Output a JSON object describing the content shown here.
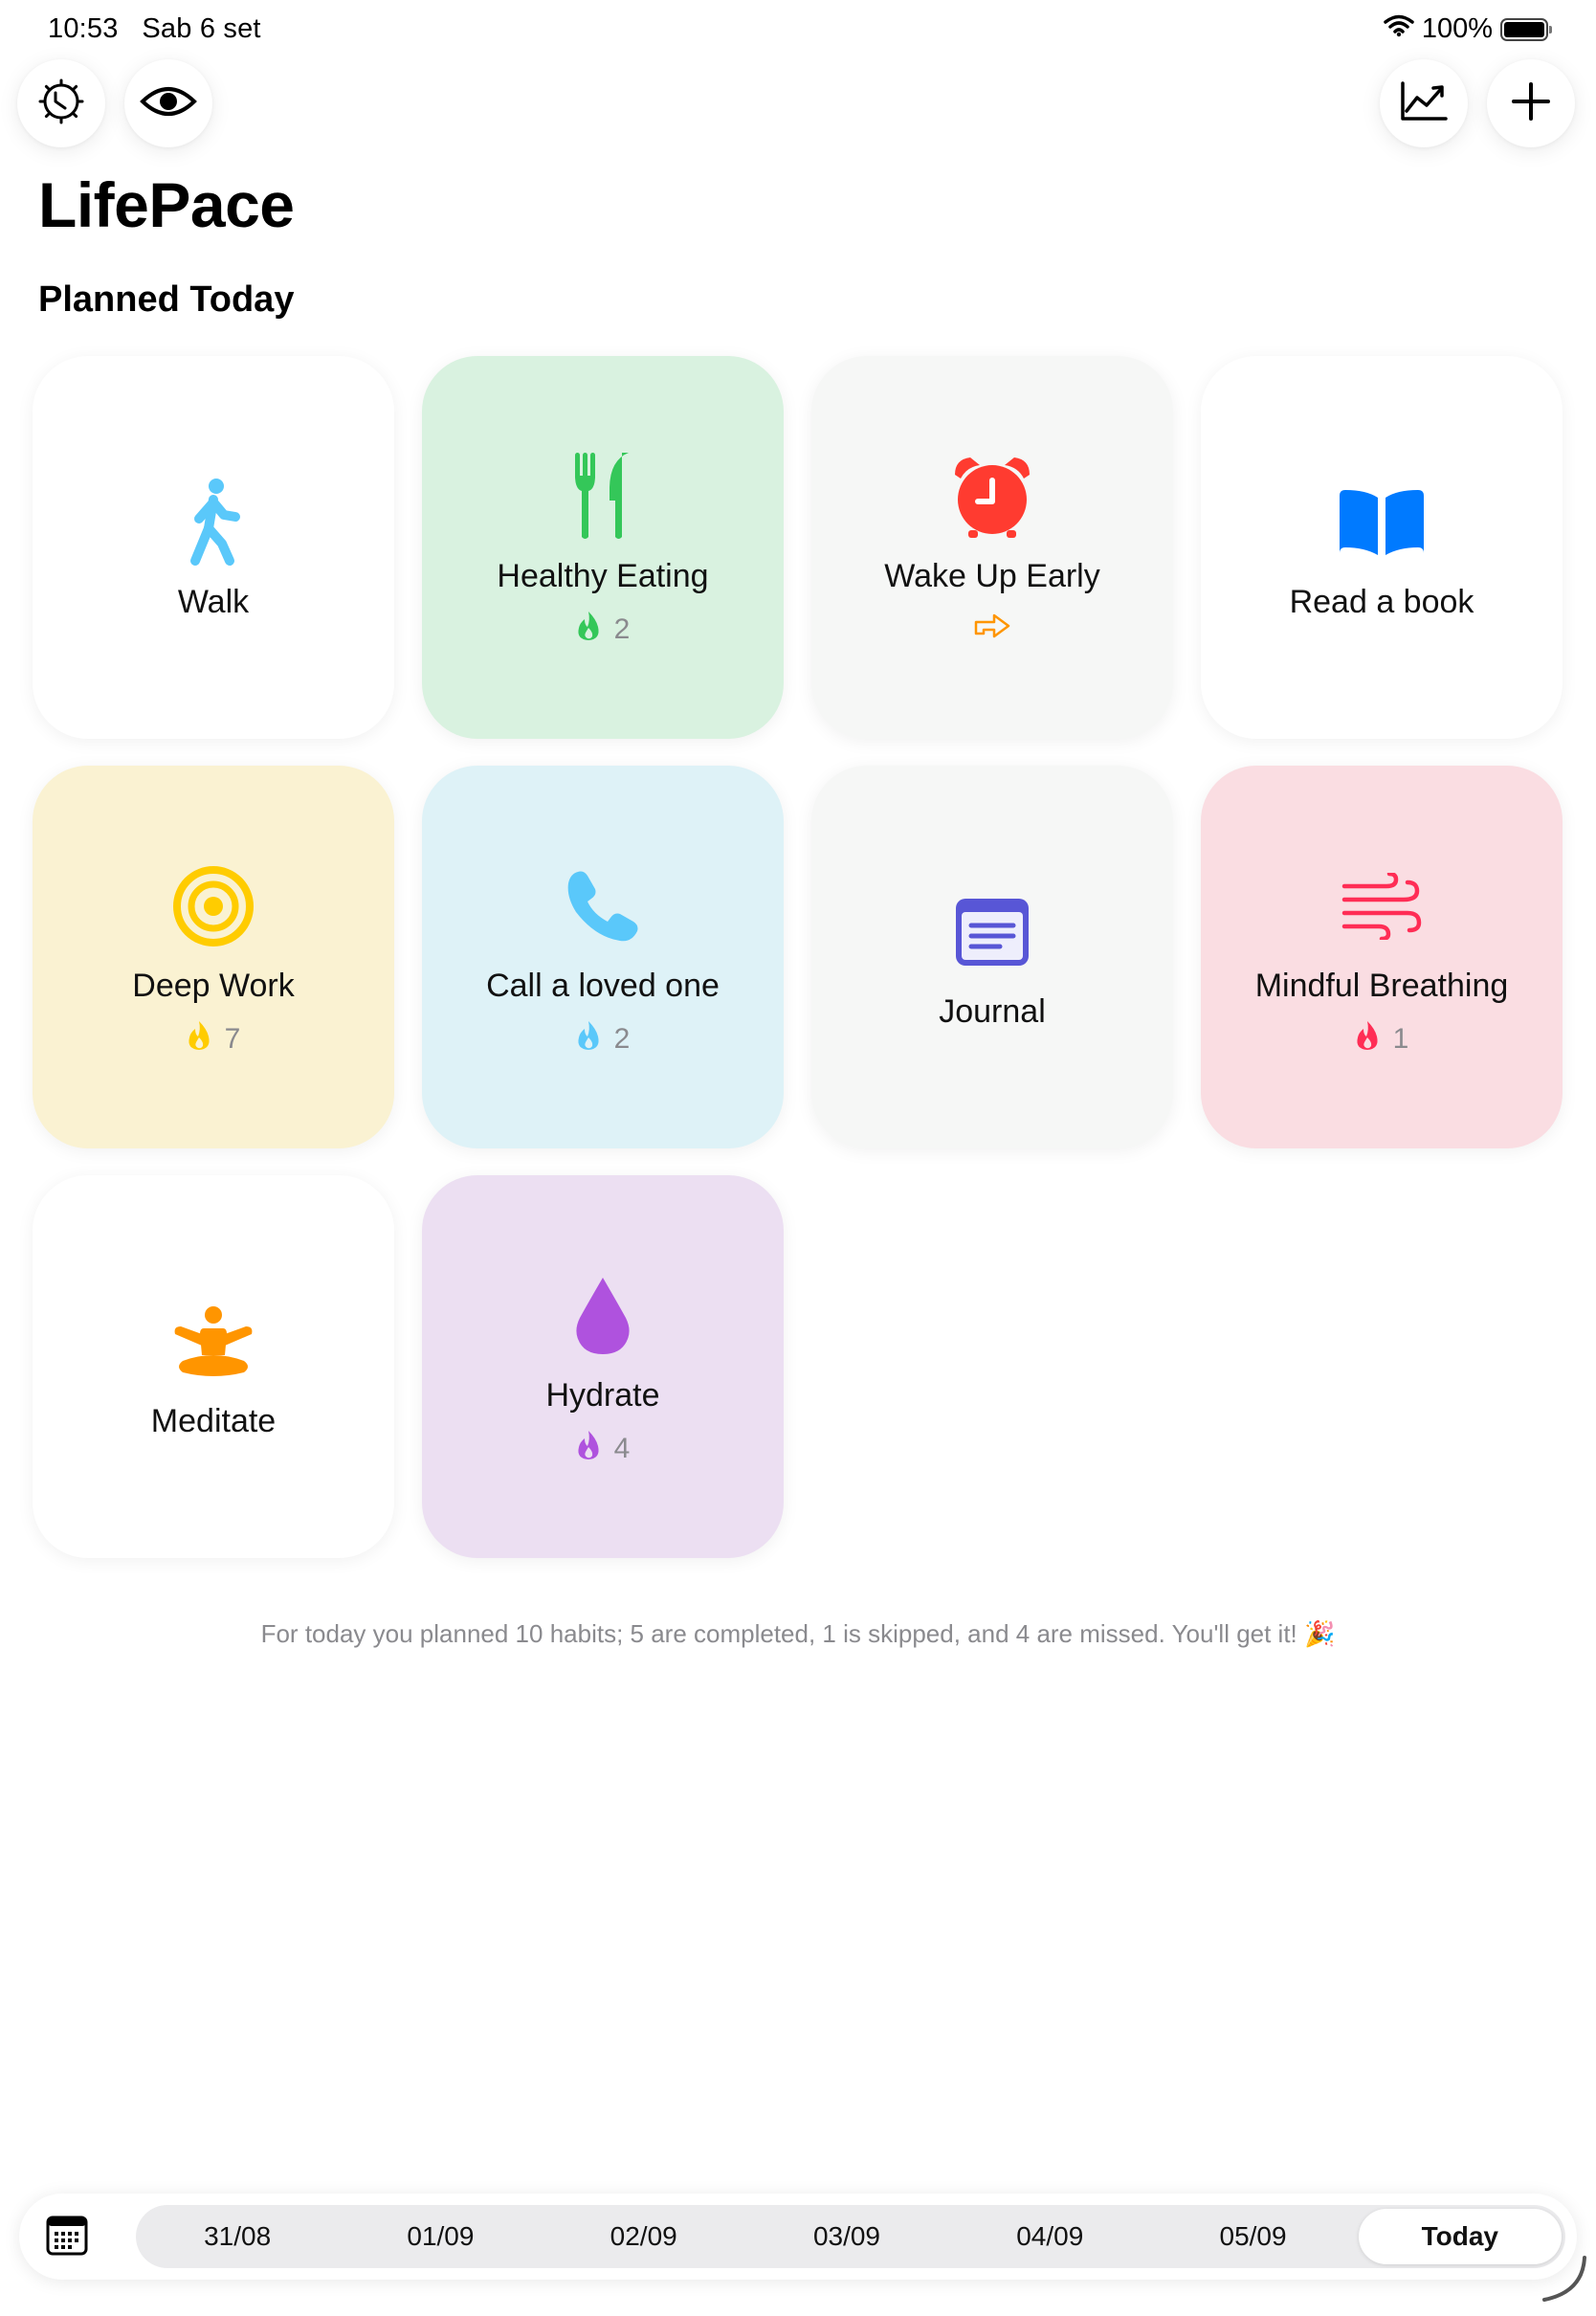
{
  "status": {
    "time": "10:53",
    "date": "Sab 6 set",
    "battery": "100%"
  },
  "header": {
    "title": "LifePace",
    "section": "Planned Today",
    "settings_icon": "gear-clock-icon",
    "visibility_icon": "eye-icon",
    "stats_icon": "chart-line-icon",
    "add_icon": "plus-icon"
  },
  "habits": [
    {
      "name": "Walk",
      "icon": "walking-figure-icon",
      "bg": "#f7f7f5",
      "color": "#5ac8fa",
      "streak": null
    },
    {
      "name": "Healthy Eating",
      "icon": "fork-knife-icon",
      "bg": "#d9f2e0",
      "color": "#34c759",
      "streak": "2"
    },
    {
      "name": "Wake Up Early",
      "icon": "alarm-clock-icon",
      "bg": "#f6f7f6",
      "color": "#ff3b30",
      "streak": "skipped"
    },
    {
      "name": "Read a book",
      "icon": "book-icon",
      "bg": "#f7f7f5",
      "color": "#007aff",
      "streak": null
    },
    {
      "name": "Deep Work",
      "icon": "target-icon",
      "bg": "#faf2d2",
      "color": "#ffcc00",
      "streak": "7"
    },
    {
      "name": "Call a loved one",
      "icon": "phone-icon",
      "bg": "#def2f7",
      "color": "#5ac8fa",
      "streak": "2"
    },
    {
      "name": "Journal",
      "icon": "journal-icon",
      "bg": "#f6f7f6",
      "color": "#5856d6",
      "streak": null
    },
    {
      "name": "Mindful Breathing",
      "icon": "wind-icon",
      "bg": "#fadde2",
      "color": "#ff2d55",
      "streak": "1"
    },
    {
      "name": "Meditate",
      "icon": "meditation-figure-icon",
      "bg": "#f7f7f5",
      "color": "#ff9500",
      "streak": null
    },
    {
      "name": "Hydrate",
      "icon": "water-drop-icon",
      "bg": "#ecdff2",
      "color": "#af52de",
      "streak": "4"
    }
  ],
  "summary": "For today you planned 10 habits; 5 are completed, 1 is skipped, and 4 are missed. You'll get it! 🎉",
  "dates": [
    "31/08",
    "01/09",
    "02/09",
    "03/09",
    "04/09",
    "05/09",
    "Today"
  ],
  "selected_date": "Today"
}
